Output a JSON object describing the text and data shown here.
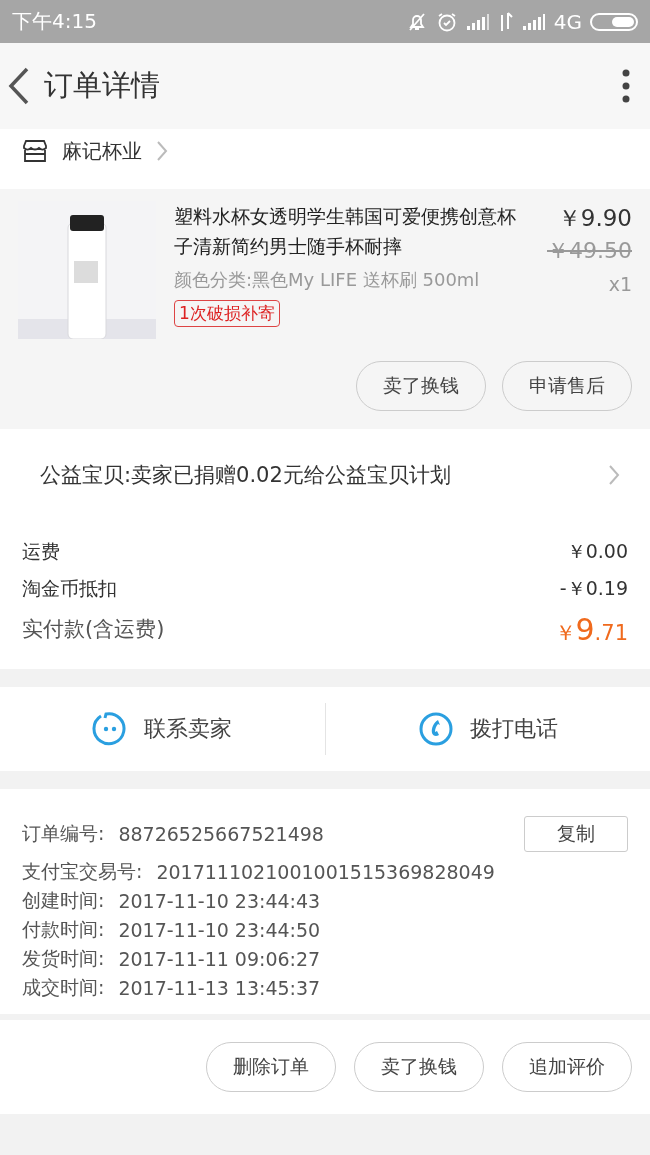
{
  "status_bar": {
    "time": "下午4:15",
    "network": "4G"
  },
  "header": {
    "title": "订单详情"
  },
  "shop": {
    "name": "麻记杯业"
  },
  "product": {
    "image": {
      "kind": "picture"
    },
    "title": "塑料水杯女透明学生韩国可爱便携创意杯子清新简约男士随手杯耐摔",
    "spec": "颜色分类:黑色My  LIFE 送杯刷 500ml",
    "tag": "1次破损补寄",
    "price": "￥9.90",
    "original_price": "￥49.50",
    "quantity": "x1",
    "actions": [
      "卖了换钱",
      "申请售后"
    ]
  },
  "charity": {
    "text": "公益宝贝:卖家已捐赠0.02元给公益宝贝计划"
  },
  "fees": [
    {
      "label": "运费",
      "value": "￥0.00"
    },
    {
      "label": "淘金币抵扣",
      "value": "-￥0.19"
    }
  ],
  "total": {
    "label": "实付款(含运费)",
    "currency": "￥",
    "integer": "9",
    "decimal": ".71"
  },
  "contact": [
    {
      "kind": "chat",
      "label": "联系卖家"
    },
    {
      "kind": "phone",
      "label": "拨打电话"
    }
  ],
  "order_info": {
    "copy_button": "复制",
    "rows": [
      {
        "label": "订单编号:",
        "value": "88726525667521498"
      },
      {
        "label": "支付宝交易号:",
        "value": "2017111021001001515369828049"
      },
      {
        "label": "创建时间:",
        "value": "2017-11-10 23:44:43"
      },
      {
        "label": "付款时间:",
        "value": "2017-11-10 23:44:50"
      },
      {
        "label": "发货时间:",
        "value": "2017-11-11 09:06:27"
      },
      {
        "label": "成交时间:",
        "value": "2017-11-13 13:45:37"
      }
    ]
  },
  "bottom_actions": [
    "删除订单",
    "卖了换钱",
    "追加评价"
  ]
}
